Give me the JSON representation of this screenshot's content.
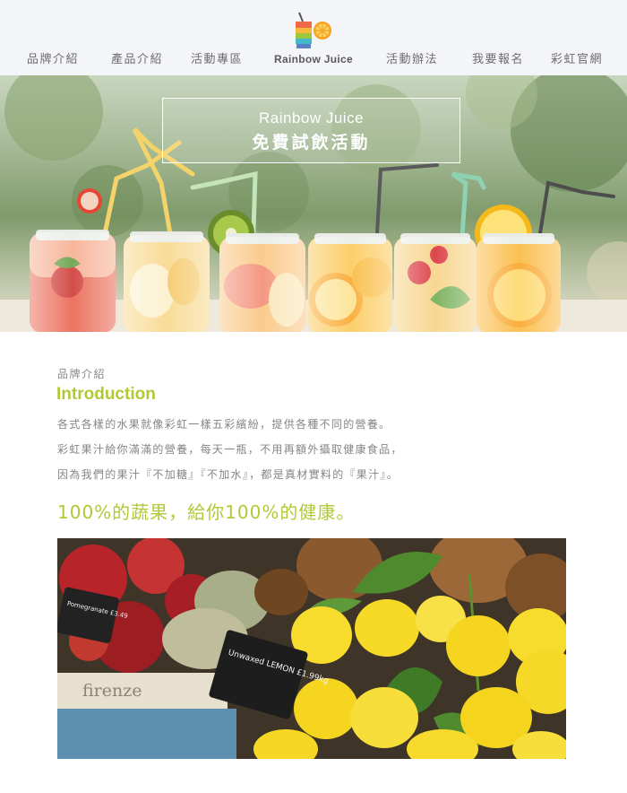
{
  "nav": {
    "items": [
      "品牌介紹",
      "產品介紹",
      "活動專區",
      "活動辦法",
      "我要報名",
      "彩虹官網"
    ],
    "logo_text": "Rainbow Juice"
  },
  "hero": {
    "subtitle": "Rainbow Juice",
    "title": "免費試飲活動"
  },
  "intro": {
    "label": "品牌介紹",
    "title": "Introduction",
    "paragraphs": [
      "各式各樣的水果就像彩虹一樣五彩繽紛，提供各種不同的營養。",
      "彩虹果汁給你滿滿的營養，每天一瓶，不用再額外攝取健康食品，",
      "因為我們的果汁『不加糖』『不加水』，都是真材實料的『果汁』。"
    ],
    "tagline": "100%的蔬果，給你100%的健康。"
  },
  "photo": {
    "sign_left": "Pomegranate £3.49",
    "sign_lemon": "Unwaxed LEMON £1.99kg",
    "crate_text": "firenze"
  },
  "colors": {
    "accent": "#b2c936",
    "nav_bg": "#f4f5f8",
    "body_text": "#858585"
  }
}
